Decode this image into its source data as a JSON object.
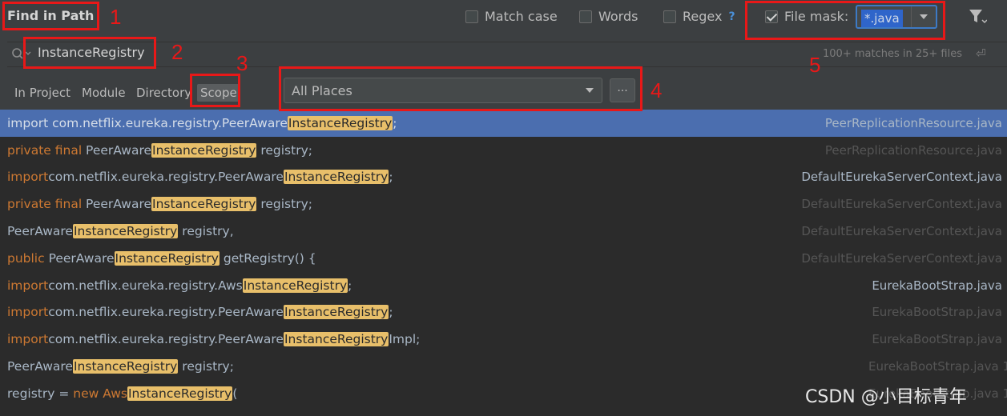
{
  "header": {
    "title": "Find in Path",
    "match_case": "Match case",
    "words": "Words",
    "regex": "Regex",
    "regex_help": "?",
    "file_mask_label": "File mask:",
    "file_mask_value": "*.java"
  },
  "search": {
    "query": "InstanceRegistry",
    "matches": "100+ matches in 25+ files"
  },
  "scope_tabs": [
    "In Project",
    "Module",
    "Directory",
    "Scope"
  ],
  "scope": {
    "selected": "All Places",
    "more": "..."
  },
  "annotations": [
    "1",
    "2",
    "3",
    "4",
    "5"
  ],
  "results": [
    {
      "pre": "import com.netflix.eureka.registry.PeerAware",
      "kw": "",
      "mid": "",
      "match": "InstanceRegistry",
      "post": ";",
      "file": "PeerReplicationResource.java"
    },
    {
      "pre": " PeerAware",
      "kw": "private final",
      "mid": "",
      "match": "InstanceRegistry",
      "post": " registry;",
      "file": "PeerReplicationResource.java"
    },
    {
      "pre": "com.netflix.eureka.registry.PeerAware",
      "kw": "import",
      "mid": "",
      "match": "InstanceRegistry",
      "post": ";",
      "file": "DefaultEurekaServerContext.java"
    },
    {
      "pre": " PeerAware",
      "kw": "private final",
      "mid": "",
      "match": "InstanceRegistry",
      "post": " registry;",
      "file": "DefaultEurekaServerContext.java"
    },
    {
      "pre": "PeerAware",
      "kw": "",
      "mid": "",
      "match": "InstanceRegistry",
      "post": " registry,",
      "file": "DefaultEurekaServerContext.java"
    },
    {
      "pre": " PeerAware",
      "kw": "public",
      "mid": "",
      "match": "InstanceRegistry",
      "post": " getRegistry() {",
      "file": "DefaultEurekaServerContext.java"
    },
    {
      "pre": "com.netflix.eureka.registry.Aws",
      "kw": "import",
      "mid": "",
      "match": "InstanceRegistry",
      "post": ";",
      "file": "EurekaBootStrap.java"
    },
    {
      "pre": "com.netflix.eureka.registry.PeerAware",
      "kw": "import",
      "mid": "",
      "match": "InstanceRegistry",
      "post": ";",
      "file": "EurekaBootStrap.java"
    },
    {
      "pre": "com.netflix.eureka.registry.PeerAware",
      "kw": "import",
      "mid": "",
      "match": "InstanceRegistry",
      "post": "Impl;",
      "file": "EurekaBootStrap.java"
    },
    {
      "pre": "PeerAware",
      "kw": "",
      "mid": "",
      "match": "InstanceRegistry",
      "post": " registry;",
      "file": "EurekaBootStrap.java 1"
    },
    {
      "pre": "registry = ",
      "kw": "",
      "mid": "new",
      "match": "InstanceRegistry",
      "post": "(",
      "file": "EurekaBootStrap.java 1"
    }
  ],
  "watermark": "CSDN @小目标青年"
}
